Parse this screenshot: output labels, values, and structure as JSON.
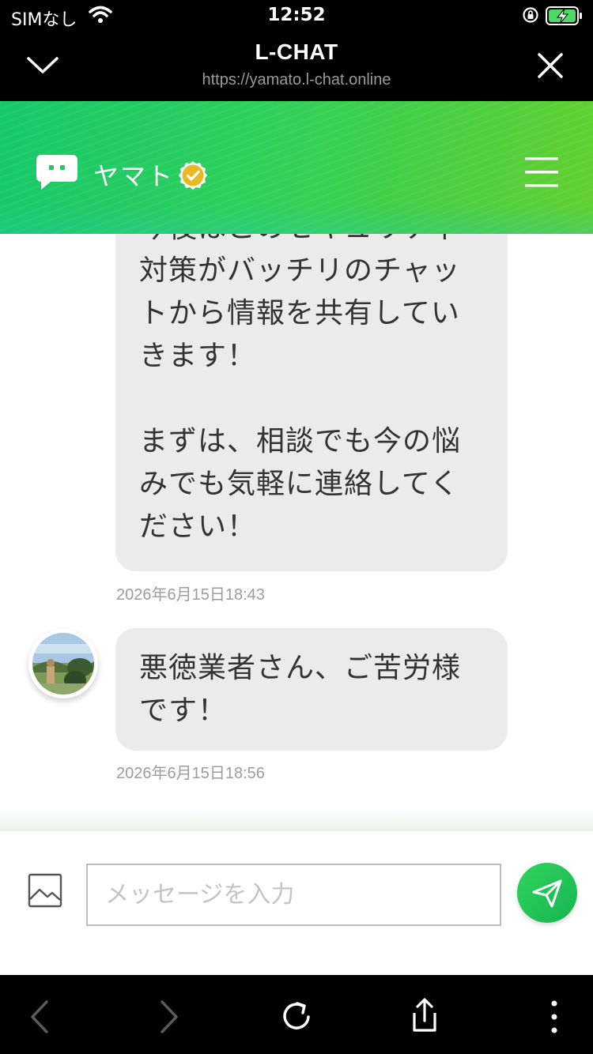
{
  "status_bar": {
    "carrier": "SIMなし",
    "time": "12:52"
  },
  "browser": {
    "title": "L-CHAT",
    "url": "https://yamato.l-chat.online"
  },
  "app_header": {
    "account_name": "ヤマト"
  },
  "messages": [
    {
      "text": "今後はこのセキュリティ対策がバッチリのチャットから情報を共有していきます！\n\nまずは、相談でも今の悩みでも気軽に連絡してください！",
      "timestamp": "2026年6月15日18:43"
    },
    {
      "text": "悪徳業者さん、ご苦労様です！",
      "timestamp": "2026年6月15日18:56"
    }
  ],
  "composer": {
    "placeholder": "メッセージを入力",
    "value": ""
  },
  "colors": {
    "brand_green": "#2fd05a",
    "bubble_gray": "#ebebeb",
    "verified_gold": "#e8b923"
  },
  "icons": [
    "wifi-icon",
    "orientation-lock-icon",
    "battery-charging-icon",
    "chevron-down-icon",
    "close-icon",
    "chat-bubble-icon",
    "verified-badge-icon",
    "hamburger-menu-icon",
    "image-icon",
    "send-icon",
    "back-icon",
    "forward-icon",
    "reload-icon",
    "share-icon",
    "more-icon"
  ]
}
